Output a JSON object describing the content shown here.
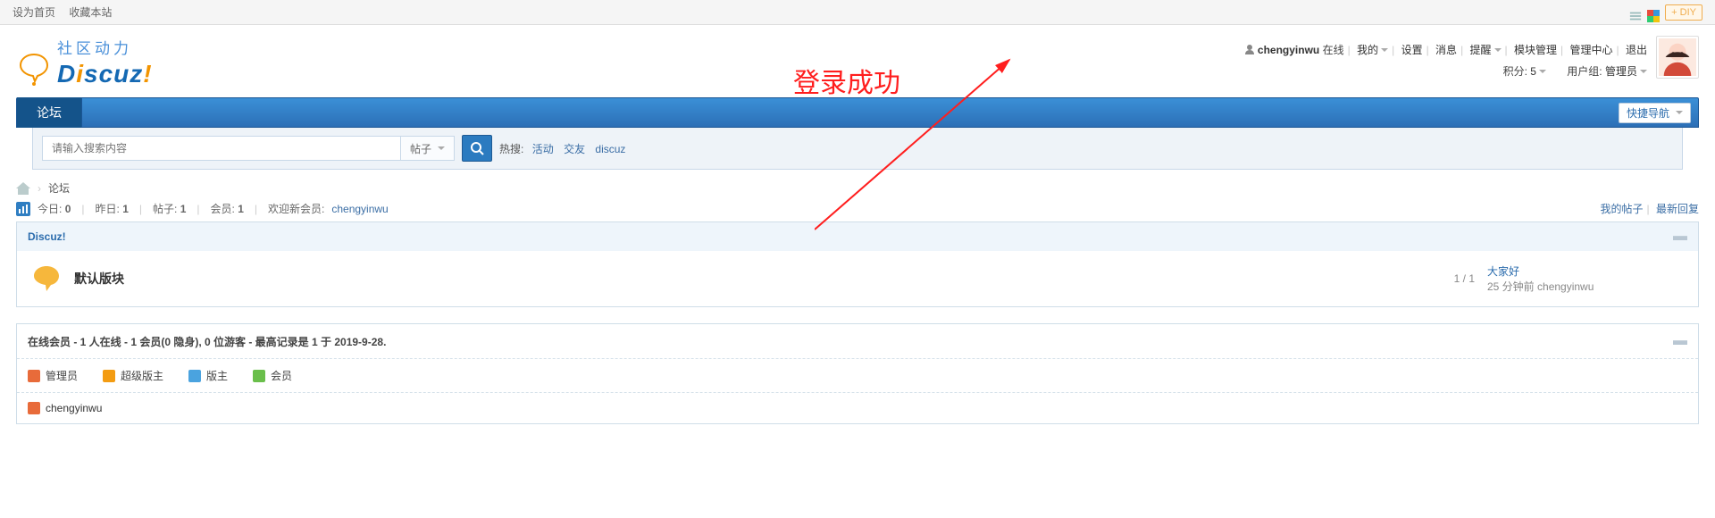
{
  "topbar": {
    "set_home": "设为首页",
    "favorite": "收藏本站",
    "diy": "+ DIY"
  },
  "logo": {
    "tag": "社区动力",
    "brand_d": "D",
    "brand_i": "i",
    "brand_rest": "scuz",
    "brand_ex": "!"
  },
  "user": {
    "name": "chengyinwu",
    "status": "在线",
    "my": "我的",
    "settings": "设置",
    "messages": "消息",
    "notices": "提醒",
    "modules": "模块管理",
    "admin": "管理中心",
    "logout": "退出",
    "points_lbl": "积分:",
    "points_val": "5",
    "group_lbl": "用户组:",
    "group_val": "管理员"
  },
  "nav": {
    "forum": "论坛",
    "quick": "快捷导航"
  },
  "search": {
    "placeholder": "请输入搜索内容",
    "type": "帖子",
    "hot_lbl": "热搜:",
    "hot": [
      "活动",
      "交友",
      "discuz"
    ]
  },
  "crumb": {
    "cur": "论坛"
  },
  "stats": {
    "today_lbl": "今日:",
    "today": "0",
    "yesterday_lbl": "昨日:",
    "yesterday": "1",
    "posts_lbl": "帖子:",
    "posts": "1",
    "members_lbl": "会员:",
    "members": "1",
    "welcome_lbl": "欢迎新会员:",
    "welcome_user": "chengyinwu",
    "myposts": "我的帖子",
    "latest": "最新回复"
  },
  "section": {
    "title": "Discuz!",
    "forum_name": "默认版块",
    "threads": "1",
    "slash": " / ",
    "posts": "1",
    "last_title": "大家好",
    "last_meta": "25 分钟前 chengyinwu"
  },
  "online": {
    "head": "在线会员 - 1 人在线 - 1 会员(0 隐身), 0 位游客 - 最高记录是 1 于 2019-9-28.",
    "roles": {
      "admin": "管理员",
      "smod": "超级版主",
      "mod": "版主",
      "member": "会员"
    },
    "users": [
      "chengyinwu"
    ]
  },
  "annotation": "登录成功"
}
